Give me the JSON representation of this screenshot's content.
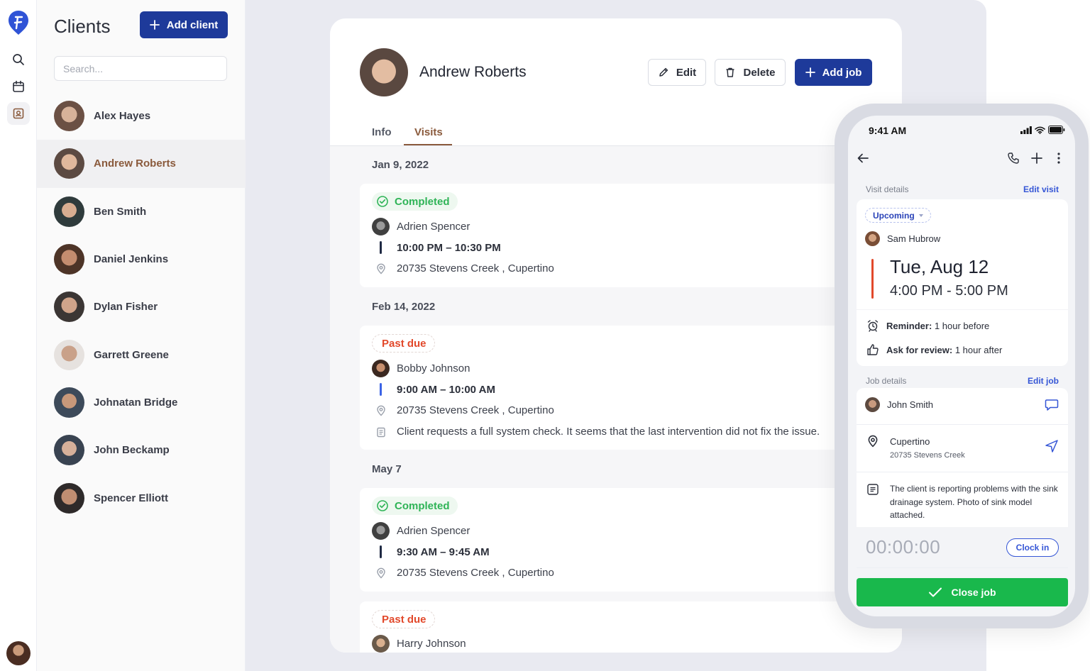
{
  "clients_panel": {
    "title": "Clients",
    "add_client_label": "Add client",
    "search_placeholder": "Search...",
    "items": [
      {
        "name": "Alex Hayes"
      },
      {
        "name": "Andrew Roberts"
      },
      {
        "name": "Ben Smith"
      },
      {
        "name": "Daniel Jenkins"
      },
      {
        "name": "Dylan Fisher"
      },
      {
        "name": "Garrett Greene"
      },
      {
        "name": "Johnatan Bridge"
      },
      {
        "name": "John Beckamp"
      },
      {
        "name": "Spencer Elliott"
      }
    ],
    "selected": "Andrew Roberts"
  },
  "client_detail": {
    "name": "Andrew Roberts",
    "edit_label": "Edit",
    "delete_label": "Delete",
    "add_job_label": "Add job",
    "tabs": [
      {
        "label": "Info"
      },
      {
        "label": "Visits"
      }
    ],
    "active_tab": "Visits",
    "visits": [
      {
        "date": "Jan 9, 2022",
        "status": "Completed",
        "worker": "Adrien Spencer",
        "time": "10:00 PM – 10:30 PM",
        "address": "20735 Stevens Creek , Cupertino",
        "note": ""
      },
      {
        "date": "Feb 14, 2022",
        "status": "Past due",
        "worker": "Bobby Johnson",
        "time": "9:00 AM – 10:00 AM",
        "address": "20735 Stevens Creek , Cupertino",
        "note": "Client requests a full system check. It seems that the last intervention did not fix the issue."
      },
      {
        "date": "May 7",
        "status": "Completed",
        "worker": "Adrien Spencer",
        "time": "9:30 AM – 9:45 AM",
        "address": "20735 Stevens Creek , Cupertino",
        "note": ""
      },
      {
        "date": "",
        "status": "Past due",
        "worker": "Harry Johnson",
        "time": "",
        "address": "",
        "note": ""
      }
    ]
  },
  "phone": {
    "status_time": "9:41 AM",
    "visit_details_label": "Visit details",
    "edit_visit_label": "Edit visit",
    "status": "Upcoming",
    "assignee": "Sam Hubrow",
    "date": "Tue, Aug 12",
    "time_range": "4:00 PM - 5:00 PM",
    "reminder_label": "Reminder:",
    "reminder_value": "1 hour before",
    "review_label": "Ask for review:",
    "review_value": "1 hour after",
    "job_details_label": "Job details",
    "edit_job_label": "Edit job",
    "job_client": "John Smith",
    "job_city": "Cupertino",
    "job_address": "20735 Stevens Creek",
    "job_note": "The client is reporting problems with the sink drainage system. Photo of sink model attached.",
    "timer": "00:00:00",
    "clock_in_label": "Clock in",
    "close_job_label": "Close job"
  },
  "colors": {
    "brand_blue": "#1e3a9a",
    "accent_brown": "#8a5a3c",
    "completed_green": "#2fb457",
    "past_due_red": "#e2492b",
    "close_job_green": "#19b84c"
  },
  "icons": [
    "logo-icon",
    "search-icon",
    "calendar-icon",
    "contacts-icon",
    "plus-icon",
    "pencil-icon",
    "trash-icon",
    "check-circle-icon",
    "location-pin-icon",
    "note-icon",
    "back-arrow-icon",
    "phone-icon",
    "more-vertical-icon",
    "alarm-icon",
    "thumbs-up-icon",
    "chat-icon",
    "navigation-icon",
    "checkmark-icon"
  ]
}
